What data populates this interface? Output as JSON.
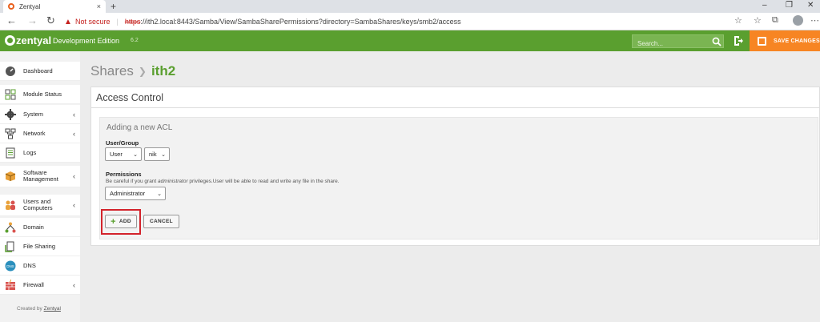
{
  "browser": {
    "tab_title": "Zentyal",
    "tab_close": "×",
    "new_tab": "+",
    "win_min": "–",
    "win_max": "❐",
    "win_close": "✕",
    "back": "←",
    "forward": "→",
    "reload": "↻",
    "not_secure": "Not secure",
    "url_scheme": "https",
    "url_rest": "://ith2.local:8443/Samba/View/SambaSharePermissions?directory=SambaShares/keys/smb2/access"
  },
  "header": {
    "logo": "zentyal",
    "edition": "Development Edition",
    "version": "6.2",
    "search_placeholder": "Search...",
    "save_label": "SAVE CHANGES"
  },
  "sidebar": {
    "items": [
      {
        "label": "Dashboard",
        "icon": "dashboard-icon"
      },
      {
        "label": "Module Status",
        "icon": "module-status-icon"
      },
      {
        "label": "System",
        "icon": "gear-icon"
      },
      {
        "label": "Network",
        "icon": "network-icon"
      },
      {
        "label": "Logs",
        "icon": "logs-icon"
      },
      {
        "label": "Software Management",
        "icon": "package-icon"
      },
      {
        "label": "Users and Computers",
        "icon": "users-icon"
      },
      {
        "label": "Domain",
        "icon": "domain-icon"
      },
      {
        "label": "File Sharing",
        "icon": "file-sharing-icon"
      },
      {
        "label": "DNS",
        "icon": "dns-icon"
      },
      {
        "label": "Firewall",
        "icon": "firewall-icon"
      }
    ],
    "footer_prefix": "Created by ",
    "footer_link": "Zentyal"
  },
  "breadcrumb": {
    "parent": "Shares",
    "current": "ith2"
  },
  "panel": {
    "title": "Access Control",
    "form_title": "Adding a new ACL",
    "user_group_label": "User/Group",
    "user_group_type": "User",
    "user_group_value": "nik",
    "permissions_label": "Permissions",
    "hint_prefix": "Be careful if you grant ",
    "hint_emph": "administrator",
    "hint_suffix": " privileges.User will be able to read and write any file in the share.",
    "permissions_value": "Administrator",
    "add_label": "ADD",
    "cancel_label": "CANCEL"
  },
  "colors": {
    "brand_green": "#5a9f2f",
    "save_orange": "#f78523",
    "highlight_red": "#d3232b"
  }
}
